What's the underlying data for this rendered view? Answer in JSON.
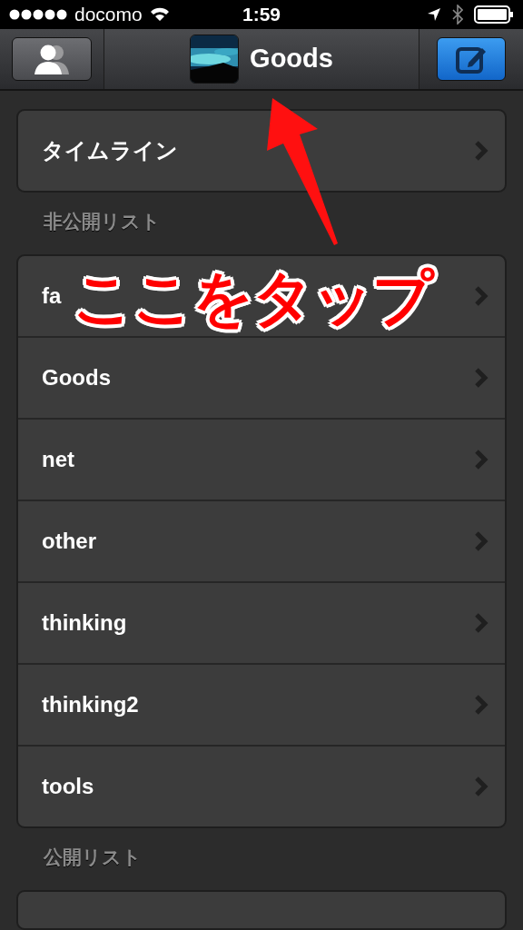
{
  "status_bar": {
    "carrier": "docomo",
    "time": "1:59"
  },
  "nav_bar": {
    "title": "Goods"
  },
  "timeline": {
    "label": "タイムライン"
  },
  "private_section": {
    "header": "非公開リスト",
    "items": [
      {
        "label": "fa"
      },
      {
        "label": "Goods"
      },
      {
        "label": "net"
      },
      {
        "label": "other"
      },
      {
        "label": "thinking"
      },
      {
        "label": "thinking2"
      },
      {
        "label": "tools"
      }
    ]
  },
  "public_section": {
    "header": "公開リスト"
  },
  "annotation": {
    "text": "ここをタップ"
  }
}
